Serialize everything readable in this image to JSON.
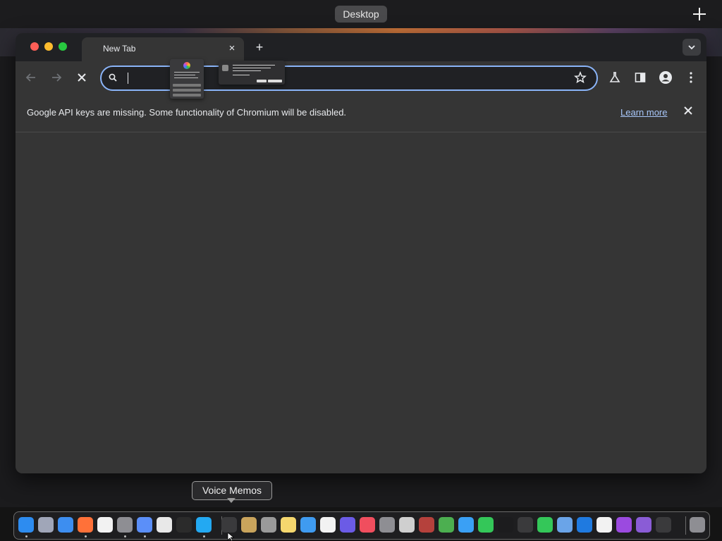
{
  "spaces_bar": {
    "desktop_label": "Desktop",
    "add_space_icon": "plus-icon"
  },
  "browser": {
    "tab": {
      "title": "New Tab",
      "close_icon": "close-icon"
    },
    "new_tab_icon": "plus-icon",
    "tab_search_icon": "chevron-down-icon",
    "toolbar": {
      "back_icon": "arrow-left-icon",
      "forward_icon": "arrow-right-icon",
      "stop_icon": "close-icon",
      "omnibox": {
        "value": "",
        "placeholder": ""
      },
      "bookmark_icon": "star-icon",
      "labs_icon": "flask-icon",
      "side_panel_icon": "side-panel-icon",
      "profile_icon": "person-icon",
      "menu_icon": "kebab-menu-icon"
    },
    "infobar": {
      "message": "Google API keys are missing. Some functionality of Chromium will be disabled.",
      "link": "Learn more"
    }
  },
  "tooltip": {
    "text": "Voice Memos"
  },
  "dock": {
    "items": [
      {
        "name": "finder",
        "color": "#2d8cf0",
        "running": true
      },
      {
        "name": "launchpad",
        "color": "#a0a6b8",
        "running": false
      },
      {
        "name": "safari",
        "color": "#3d8ef0",
        "running": false
      },
      {
        "name": "firefox",
        "color": "#ff7139",
        "running": true
      },
      {
        "name": "capcut",
        "color": "#f2f2f2",
        "running": false
      },
      {
        "name": "system-settings",
        "color": "#8e8e93",
        "running": true
      },
      {
        "name": "chromium",
        "color": "#5b8ff9",
        "running": true
      },
      {
        "name": "textedit",
        "color": "#e8e8e8",
        "running": false
      },
      {
        "name": "terminal",
        "color": "#2b2b2b",
        "running": false
      },
      {
        "name": "vscode",
        "color": "#23a9f2",
        "running": true
      },
      {
        "name": "voice-memos",
        "color": "#3a3a3c",
        "running": false
      },
      {
        "name": "notes-folder",
        "color": "#c9a45c",
        "running": false
      },
      {
        "name": "screenshot",
        "color": "#9a9a9a",
        "running": false
      },
      {
        "name": "stickies",
        "color": "#f5d76e",
        "running": false
      },
      {
        "name": "icloud",
        "color": "#3f9bf0",
        "running": false
      },
      {
        "name": "reminders",
        "color": "#f2f2f2",
        "running": false
      },
      {
        "name": "shortcuts",
        "color": "#6b5be6",
        "running": false
      },
      {
        "name": "news",
        "color": "#f04e5e",
        "running": false
      },
      {
        "name": "font-book",
        "color": "#8e8e93",
        "running": false
      },
      {
        "name": "chess",
        "color": "#cfcfcf",
        "running": false
      },
      {
        "name": "dictionary",
        "color": "#b5413c",
        "running": false
      },
      {
        "name": "chrome",
        "color": "#4caf50",
        "running": false
      },
      {
        "name": "freeform",
        "color": "#3aa0f5",
        "running": false
      },
      {
        "name": "find-my",
        "color": "#34c759",
        "running": false
      },
      {
        "name": "apple-tv",
        "color": "#1c1c1e",
        "running": false
      },
      {
        "name": "activity-monitor",
        "color": "#3a3a3c",
        "running": false
      },
      {
        "name": "messages",
        "color": "#34c759",
        "running": false
      },
      {
        "name": "screen-sharing",
        "color": "#6aa4e8",
        "running": false
      },
      {
        "name": "xcode-instruments",
        "color": "#1f7ae0",
        "running": false
      },
      {
        "name": "clock",
        "color": "#f2f2f2",
        "running": false
      },
      {
        "name": "podcasts",
        "color": "#9b4ae0",
        "running": false
      },
      {
        "name": "visual-studio",
        "color": "#8a5cd6",
        "running": false
      },
      {
        "name": "script-editor",
        "color": "#3a3a3c",
        "running": false
      },
      {
        "name": "trash",
        "color": "#8e8e93",
        "running": false
      }
    ]
  }
}
